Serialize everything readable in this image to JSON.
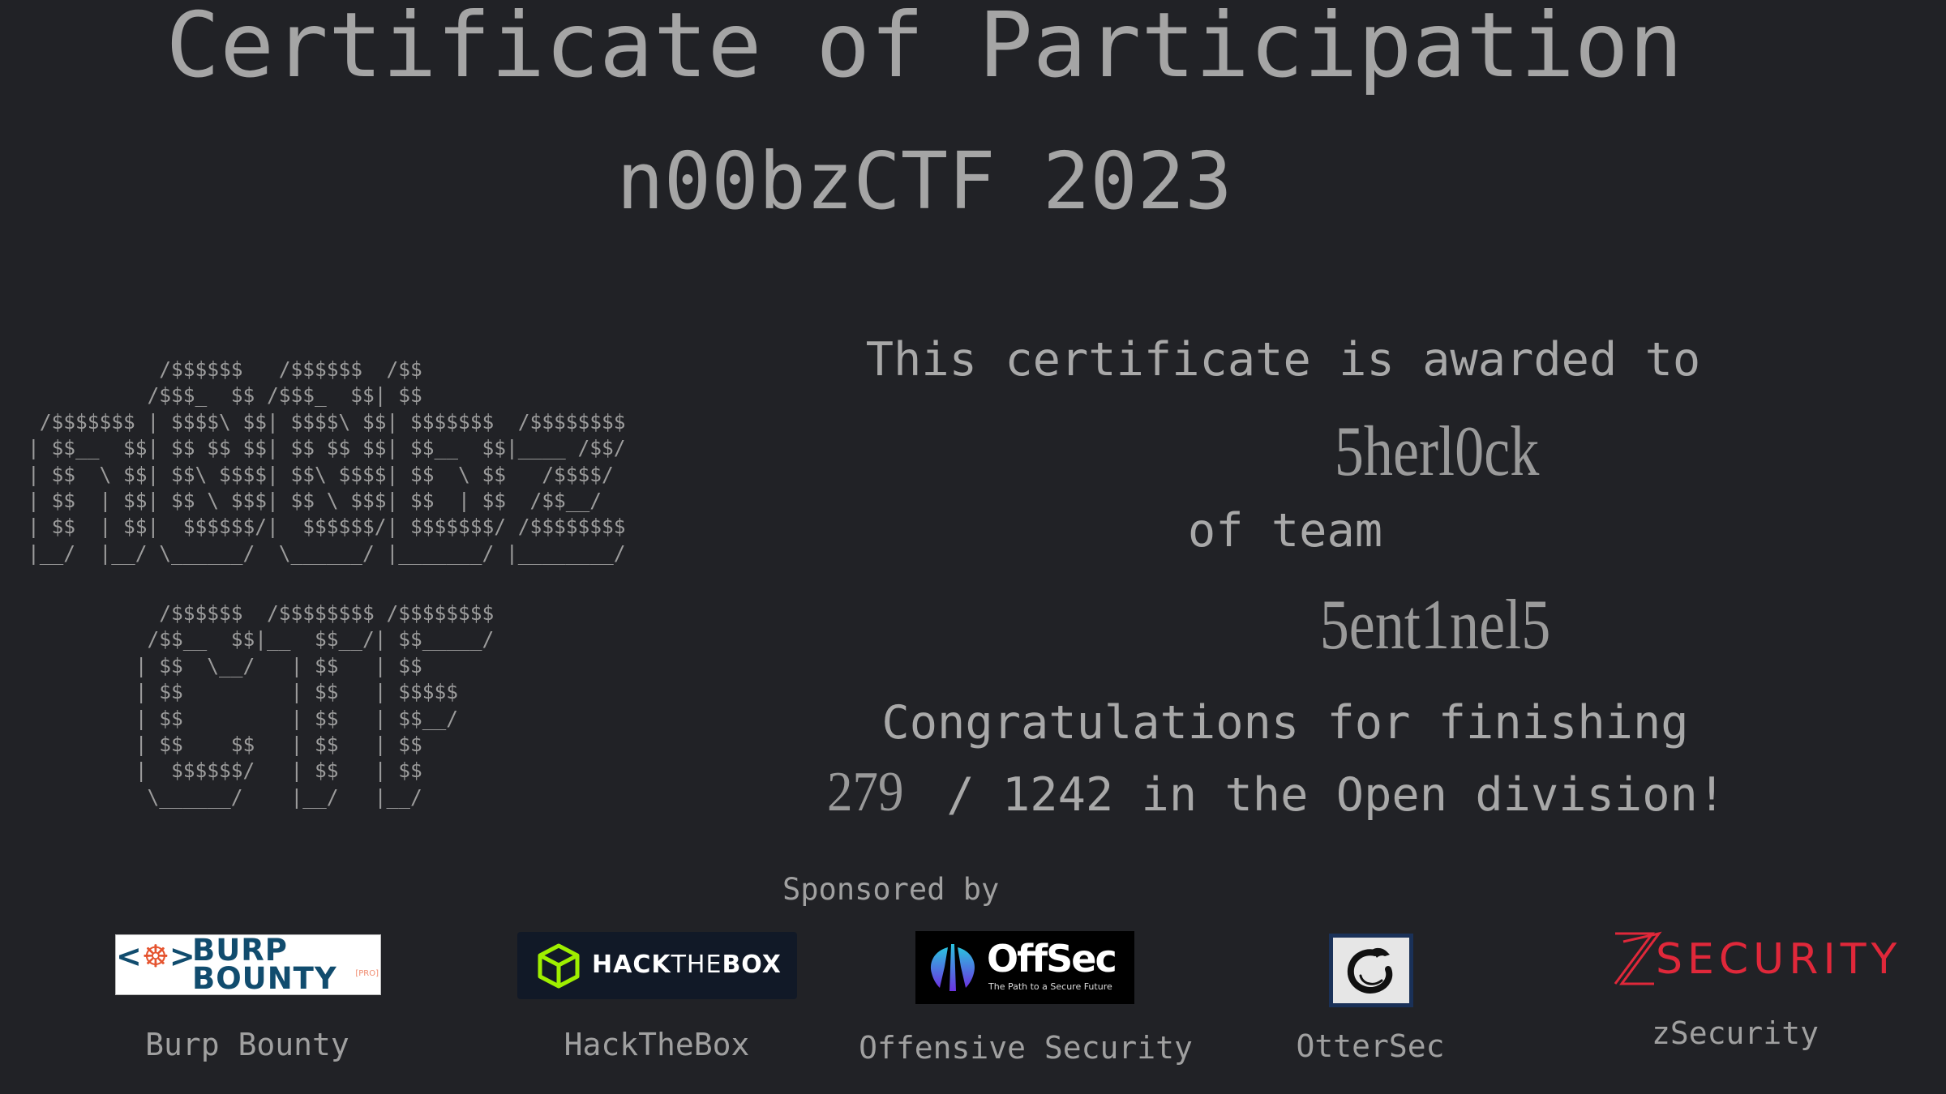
{
  "certificate": {
    "title": "Certificate of Participation",
    "event": "n00bzCTF 2023",
    "ascii_logo": {
      "n00bz_lines": [
        "           /$$$$$$   /$$$$$$  /$$",
        "          /$$$_  $$ /$$$_  $$| $$",
        " /$$$$$$$ | $$$$\\ $$| $$$$\\ $$| $$$$$$$  /$$$$$$$$",
        "| $$__  $$| $$ $$ $$| $$ $$ $$| $$__  $$|____ /$$/",
        "| $$  \\ $$| $$\\ $$$$| $$\\ $$$$| $$  \\ $$   /$$$$/",
        "| $$  | $$| $$ \\ $$$| $$ \\ $$$| $$  | $$  /$$__/",
        "| $$  | $$|  $$$$$$/|  $$$$$$/| $$$$$$$/ /$$$$$$$$",
        "|__/  |__/ \\______/  \\______/ |_______/ |________/"
      ],
      "ctf_lines": [
        "           /$$$$$$  /$$$$$$$$ /$$$$$$$$",
        "          /$$__  $$|__  $$__/| $$_____/",
        "         | $$  \\__/   | $$   | $$",
        "         | $$         | $$   | $$$$$",
        "         | $$         | $$   | $$__/",
        "         | $$    $$   | $$   | $$",
        "         |  $$$$$$/   | $$   | $$",
        "          \\______/    |__/   |__/"
      ]
    },
    "awarded_text": "This certificate is awarded to",
    "recipient": "5herl0ck",
    "of_team_text": "of team",
    "team": "5ent1nel5",
    "congrats_text": "Congratulations for finishing",
    "rank": "279",
    "rank_suffix": " / 1242 in the Open division!",
    "total_teams": "1242",
    "division": "Open"
  },
  "sponsors": {
    "heading": "Sponsored by",
    "items": [
      {
        "name": "Burp Bounty",
        "logo_text_1": "BURP",
        "logo_text_2": "BOUNTY",
        "logo_badge": "[PRO]",
        "logo_prefix": "<",
        "logo_suffix": ">",
        "colors": {
          "primary": "#114c6e",
          "accent": "#e5532e"
        }
      },
      {
        "name": "HackTheBox",
        "logo_text_bold_1": "HACK",
        "logo_text_thin": "THE",
        "logo_text_bold_2": "BOX",
        "colors": {
          "background": "#111927",
          "accent": "#9fef00"
        }
      },
      {
        "name": "Offensive Security",
        "logo_text": "OffSec",
        "logo_tagline": "The Path to a Secure Future",
        "colors": {
          "background": "#000000",
          "accent": "#2bb5e0"
        }
      },
      {
        "name": "OtterSec",
        "colors": {
          "frame": "#1a3158",
          "background": "#e6e6e6"
        }
      },
      {
        "name": "zSecurity",
        "logo_text": "ZSECURITY",
        "colors": {
          "accent": "#e0283a"
        }
      }
    ]
  },
  "colors": {
    "background": "#212226",
    "text": "#a5a5a5"
  }
}
